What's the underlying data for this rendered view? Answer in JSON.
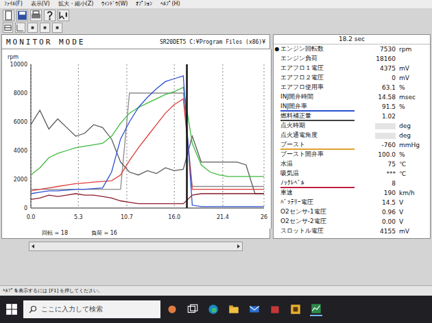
{
  "window": {
    "menu": [
      "ﾌｧｲﾙ(F)",
      "表示(V)",
      "拡大・縮小(Z)",
      "ｳｨﾝﾄﾞｳ(W)",
      "ｵﾌﾟｼｮﾝ",
      "ﾍﾙﾌﾟ(H)"
    ]
  },
  "chart_panel": {
    "title": "MONITOR MODE",
    "path": "SR20DET5 C:¥Program Files (x86)¥",
    "chart": {
      "y_unit": "rpm",
      "y_max": 10000,
      "x_max": 26,
      "y_ticks": [
        {
          "value": 0,
          "label": "0"
        },
        {
          "value": 2000,
          "label": "2000"
        },
        {
          "value": 4000,
          "label": "4000"
        },
        {
          "value": 6000,
          "label": "6000"
        },
        {
          "value": 8000,
          "label": "8000"
        },
        {
          "value": 10000,
          "label": "10000"
        }
      ],
      "x_ticks": [
        {
          "value": 0,
          "label": "0.0"
        },
        {
          "value": 5.3,
          "label": "5.3"
        },
        {
          "value": 10.7,
          "label": "10.7"
        },
        {
          "value": 16.0,
          "label": "16.0"
        },
        {
          "value": 21.4,
          "label": "21.4"
        },
        {
          "value": 26,
          "label": "26"
        }
      ],
      "times": [
        0,
        1,
        2,
        3,
        4,
        5,
        6,
        7,
        8,
        9,
        10,
        11,
        12,
        13,
        14,
        15,
        16,
        17,
        18,
        19,
        20,
        21,
        22,
        23,
        24,
        25,
        26
      ],
      "cursor_time": 17.4,
      "series": [
        {
          "color": "#8a8a8a",
          "values": [
            1300,
            1300,
            1300,
            1300,
            1300,
            1300,
            1300,
            1300,
            1300,
            1300,
            1300,
            8000,
            8000,
            8000,
            8000,
            8000,
            8000,
            8000,
            1500,
            1500,
            1500,
            1500,
            1500,
            1500,
            1500,
            1500,
            1500
          ]
        },
        {
          "color": "#5a5a5a",
          "values": [
            5800,
            6800,
            5500,
            6200,
            5600,
            5000,
            5200,
            5800,
            5600,
            4800,
            3200,
            2500,
            2300,
            2600,
            2400,
            2800,
            2600,
            2700,
            5000,
            3200,
            3200,
            3200,
            3200,
            3200,
            3000,
            1000,
            1000
          ]
        },
        {
          "color": "#8a1a2a",
          "values": [
            600,
            700,
            900,
            800,
            900,
            1000,
            900,
            900,
            800,
            700,
            500,
            400,
            300,
            300,
            300,
            300,
            300,
            300,
            900,
            1000,
            1000,
            1000,
            1000,
            1000,
            1000,
            1000,
            1000
          ]
        },
        {
          "color": "#e03a3a",
          "values": [
            1200,
            1300,
            1400,
            1500,
            1600,
            1700,
            1750,
            1800,
            1850,
            1900,
            2300,
            3300,
            4200,
            5000,
            5800,
            6600,
            7200,
            7600,
            1300,
            1300,
            1300,
            1300,
            1300,
            1300,
            1300,
            1300,
            1300
          ]
        },
        {
          "color": "#3cb83c",
          "values": [
            2300,
            2800,
            3500,
            3800,
            4000,
            4200,
            4300,
            4400,
            4500,
            5000,
            5900,
            6600,
            7000,
            7300,
            7600,
            7900,
            8100,
            8400,
            4500,
            3000,
            2500,
            2300,
            2200,
            2200,
            2200,
            2200,
            2200
          ]
        },
        {
          "color": "#2a4fd0",
          "values": [
            1000,
            1100,
            1200,
            1200,
            1250,
            1300,
            1300,
            1350,
            1400,
            2500,
            4800,
            6000,
            7000,
            7700,
            8300,
            8800,
            9000,
            9200,
            200,
            100,
            100,
            100,
            100,
            100,
            100,
            100,
            100
          ]
        }
      ]
    },
    "footer": [
      "回転 = 18",
      "負荷 = 16"
    ]
  },
  "params_panel": {
    "time": "18.2 sec",
    "mark": "●",
    "items": [
      {
        "label": "エンジン回転数",
        "value": "7530",
        "unit": "rpm",
        "selected": true,
        "redacted": false,
        "color": null
      },
      {
        "label": "エンジン負荷",
        "value": "18160",
        "unit": "",
        "selected": false,
        "redacted": false,
        "color": null
      },
      {
        "label": "エアフロ１電圧",
        "value": "4375",
        "unit": "mV",
        "selected": false,
        "redacted": false,
        "color": null
      },
      {
        "label": "エアフロ２電圧",
        "value": "0",
        "unit": "mV",
        "selected": false,
        "redacted": false,
        "color": null
      },
      {
        "label": "エアフロ使用率",
        "value": "63.1",
        "unit": "%",
        "selected": false,
        "redacted": false,
        "color": null
      },
      {
        "label": "INJ開弁時間",
        "value": "14.58",
        "unit": "msec",
        "selected": false,
        "redacted": false,
        "color": null
      },
      {
        "label": "INJ開弁率",
        "value": "91.5",
        "unit": "%",
        "selected": false,
        "redacted": false,
        "color": "#2a4fd0"
      },
      {
        "label": "燃料補正量",
        "value": "1.02",
        "unit": "",
        "selected": false,
        "redacted": false,
        "color": "#404040"
      },
      {
        "label": "点火時期",
        "value": "",
        "unit": "deg",
        "selected": false,
        "redacted": true,
        "color": null
      },
      {
        "label": "点火通電角度",
        "value": "",
        "unit": "deg",
        "selected": false,
        "redacted": true,
        "color": null
      },
      {
        "label": "ブースト",
        "value": "-760",
        "unit": "mmHg",
        "selected": false,
        "redacted": false,
        "color": "#e0a030"
      },
      {
        "label": "ブースト開弁率",
        "value": "100.0",
        "unit": "%",
        "selected": false,
        "redacted": false,
        "color": null
      },
      {
        "label": "水温",
        "value": "75",
        "unit": "℃",
        "selected": false,
        "redacted": false,
        "color": null
      },
      {
        "label": "吸気温",
        "value": "***",
        "unit": "℃",
        "selected": false,
        "redacted": false,
        "color": null
      },
      {
        "label": "ﾉｯｸﾚﾍﾞﾙ",
        "value": "8",
        "unit": "",
        "selected": false,
        "redacted": false,
        "color": "#c02040"
      },
      {
        "label": "車速",
        "value": "190",
        "unit": "km/h",
        "selected": false,
        "redacted": false,
        "color": null
      },
      {
        "label": "ﾊﾞｯﾃﾘｰ電圧",
        "value": "14.5",
        "unit": "V",
        "selected": false,
        "redacted": false,
        "color": null
      },
      {
        "label": "O2センサ-1電圧",
        "value": "0.96",
        "unit": "V",
        "selected": false,
        "redacted": false,
        "color": null
      },
      {
        "label": "O2センサ-2電圧",
        "value": "0.00",
        "unit": "V",
        "selected": false,
        "redacted": false,
        "color": null
      },
      {
        "label": "スロットル電圧",
        "value": "4155",
        "unit": "mV",
        "selected": false,
        "redacted": false,
        "color": null
      }
    ]
  },
  "status_bar": "ﾍﾙﾌﾟを表示するには [F1] を押してください。",
  "taskbar": {
    "search_placeholder": "ここに入力して検索"
  }
}
